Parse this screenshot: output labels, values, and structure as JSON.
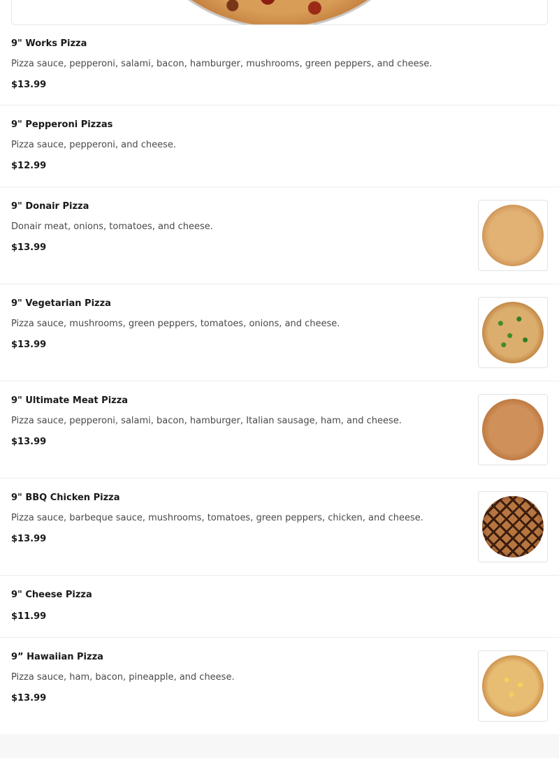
{
  "items": [
    {
      "name": "9\" Works Pizza",
      "description": "Pizza sauce, pepperoni, salami, bacon, hamburger, mushrooms, green peppers, and cheese.",
      "price": "$13.99",
      "image": null
    },
    {
      "name": "9\" Pepperoni Pizzas",
      "description": "Pizza sauce, pepperoni, and cheese.",
      "price": "$12.99",
      "image": null
    },
    {
      "name": "9\" Donair Pizza",
      "description": "Donair meat, onions, tomatoes, and cheese.",
      "price": "$13.99",
      "image": "donair-pizza-image"
    },
    {
      "name": "9\" Vegetarian Pizza",
      "description": "Pizza sauce, mushrooms, green peppers, tomatoes, onions, and cheese.",
      "price": "$13.99",
      "image": "vegetarian-pizza-image"
    },
    {
      "name": "9\" Ultimate Meat Pizza",
      "description": "Pizza sauce, pepperoni, salami, bacon, hamburger, Italian sausage, ham, and cheese.",
      "price": "$13.99",
      "image": "ultimate-meat-pizza-image"
    },
    {
      "name": "9\" BBQ Chicken Pizza",
      "description": "Pizza sauce, barbeque sauce, mushrooms, tomatoes, green peppers, chicken, and cheese.",
      "price": "$13.99",
      "image": "bbq-chicken-pizza-image"
    },
    {
      "name": "9\" Cheese Pizza",
      "description": "",
      "price": "$11.99",
      "image": null
    },
    {
      "name": "9” Hawaiian Pizza",
      "description": "Pizza sauce, ham, bacon, pineapple, and cheese.",
      "price": "$13.99",
      "image": "hawaiian-pizza-image"
    }
  ]
}
